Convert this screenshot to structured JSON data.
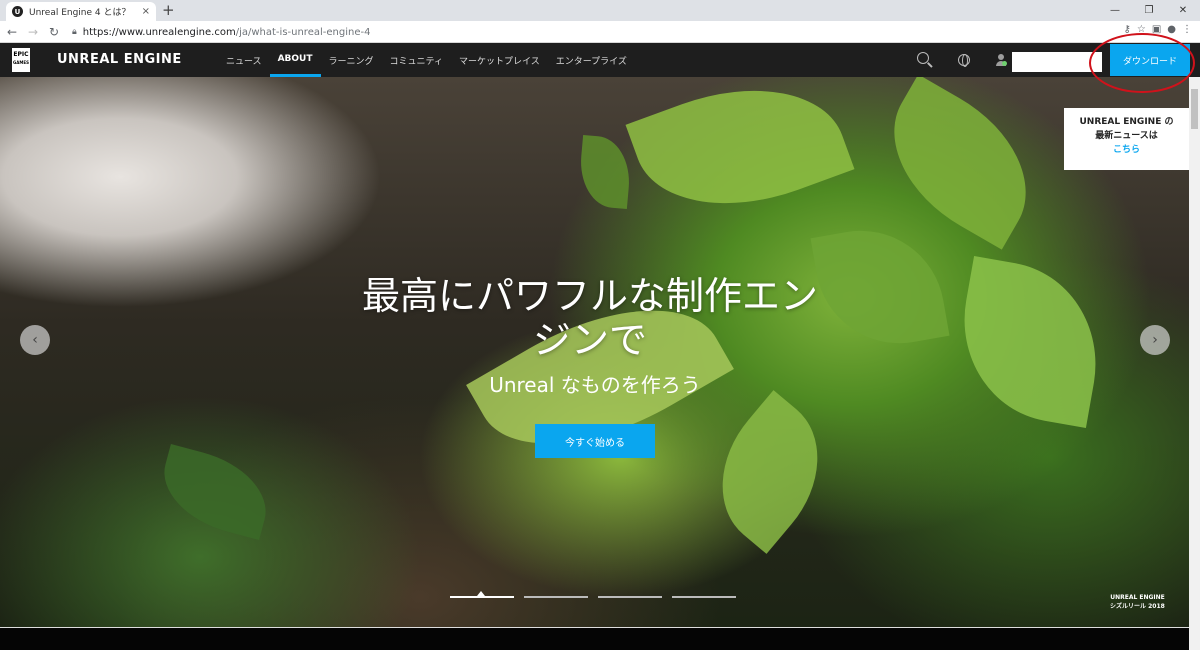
{
  "browser": {
    "tab_title": "Unreal Engine 4 とは？",
    "tab_favicon": "U",
    "tab_close": "×",
    "new_tab": "+",
    "url_host": "https://www.unrealengine.com",
    "url_path": "/ja/what-is-unreal-engine-4",
    "window_controls": [
      "—",
      "❐",
      "✕"
    ],
    "nav_icons": [
      "arrow-left-icon",
      "arrow-right-icon",
      "reload-icon"
    ]
  },
  "nav": {
    "epic_logo": "EPIC",
    "epic_logo_sub": "GAMES",
    "brand": "UNREAL ENGINE",
    "items": [
      {
        "label": "ニュース"
      },
      {
        "label": "ABOUT"
      },
      {
        "label": "ラーニング"
      },
      {
        "label": "コミュニティ"
      },
      {
        "label": "マーケットプレイス"
      },
      {
        "label": "エンタープライズ"
      }
    ],
    "download": "ダウンロード"
  },
  "hero": {
    "title_line1": "最高にパワフルな制作エン",
    "title_line2": "ジンで",
    "subtitle": "Unreal なものを作ろう",
    "cta": "今すぐ始める",
    "prev": "‹",
    "next": "›",
    "news_line1": "UNREAL ENGINE の",
    "news_line2": "最新ニュースは",
    "news_link": "こちら",
    "reel_line1": "UNREAL ENGINE",
    "reel_line2": "シズルリール 2018"
  },
  "colors": {
    "accent": "#0aa6ef",
    "nav_bg": "#1e1e1e",
    "annotation": "#d0121b"
  }
}
